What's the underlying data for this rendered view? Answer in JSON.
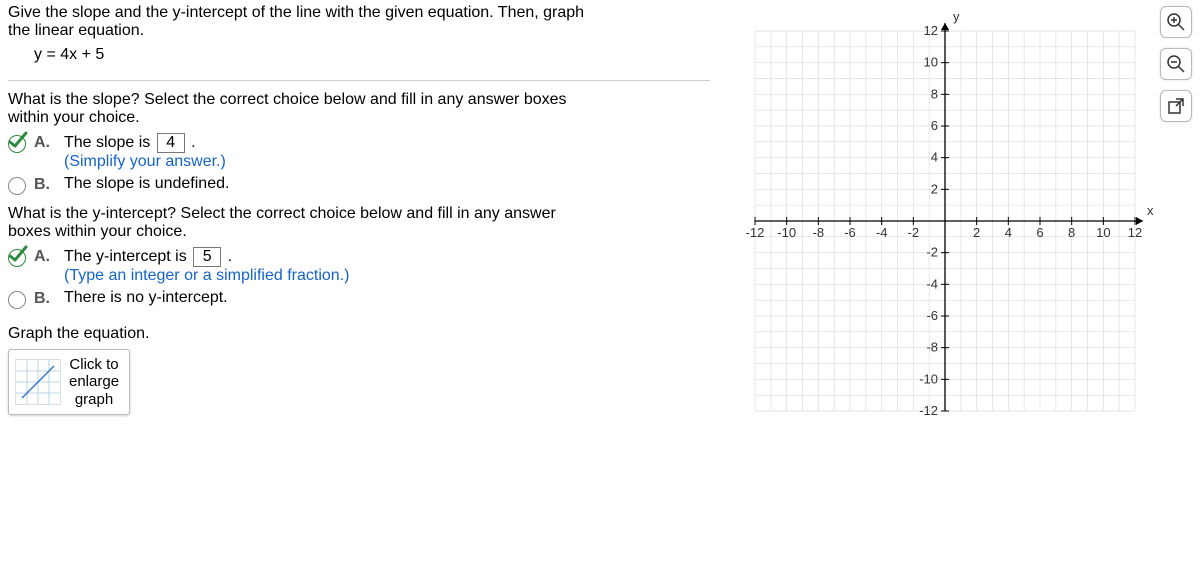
{
  "question": {
    "prompt_line1": "Give the slope and the y-intercept of the line with the given equation.  Then, graph",
    "prompt_line2": "the linear equation.",
    "equation": "y = 4x + 5"
  },
  "slope_q": {
    "prompt_line1": "What is the slope? Select the correct choice below and fill in any answer boxes",
    "prompt_line2": "within your choice.",
    "A_label": "A.",
    "A_pre": "The slope is ",
    "A_value": "4",
    "A_post": " .",
    "A_hint": "(Simplify your answer.)",
    "B_label": "B.",
    "B_text": "The slope is undefined."
  },
  "yint_q": {
    "prompt_line1": "What is the y-intercept? Select the correct choice below and fill in any answer",
    "prompt_line2": "boxes within your choice.",
    "A_label": "A.",
    "A_pre": "The y-intercept is ",
    "A_value": "5",
    "A_post": " .",
    "A_hint": "(Type an integer or a simplified fraction.)",
    "B_label": "B.",
    "B_text": "There is no y-intercept."
  },
  "graph_section": {
    "heading": "Graph the equation.",
    "btn_line1": "Click to",
    "btn_line2": "enlarge",
    "btn_line3": "graph"
  },
  "chart_data": {
    "type": "line",
    "xlabel": "x",
    "ylabel": "y",
    "xlim": [
      -12,
      12
    ],
    "ylim": [
      -12,
      12
    ],
    "x_ticks": [
      -12,
      -10,
      -8,
      -6,
      -4,
      -2,
      2,
      4,
      6,
      8,
      10,
      12
    ],
    "y_ticks": [
      -12,
      -10,
      -8,
      -6,
      -4,
      -2,
      2,
      4,
      6,
      8,
      10,
      12
    ],
    "grid": true,
    "series": []
  },
  "toolbar": {
    "zoom_in": "zoom-in",
    "zoom_out": "zoom-out",
    "popout": "popout"
  }
}
